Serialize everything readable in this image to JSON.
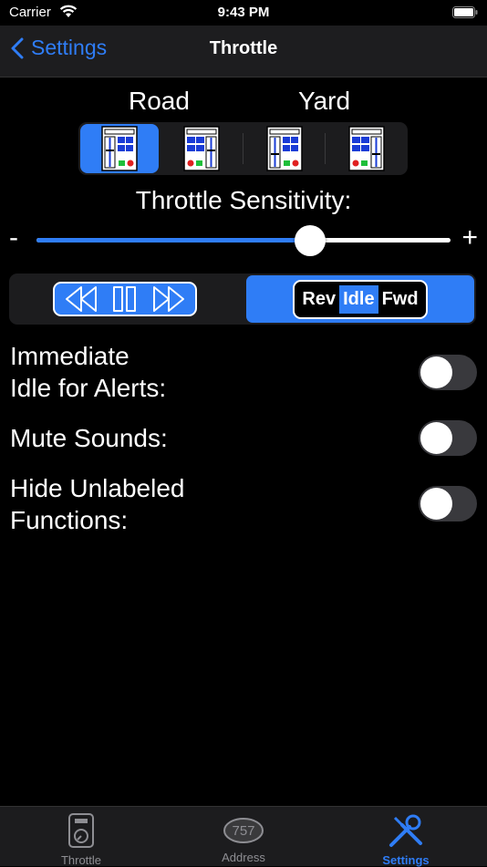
{
  "status_bar": {
    "carrier": "Carrier",
    "time": "9:43 PM"
  },
  "nav": {
    "back_label": "Settings",
    "title": "Throttle"
  },
  "layout": {
    "road_label": "Road",
    "yard_label": "Yard",
    "options": [
      {
        "name": "road-left",
        "selected": true
      },
      {
        "name": "road-right",
        "selected": false
      },
      {
        "name": "yard-left",
        "selected": false
      },
      {
        "name": "yard-right",
        "selected": false
      }
    ]
  },
  "sensitivity": {
    "label": "Throttle Sensitivity:",
    "minus": "-",
    "plus": "+",
    "value": 0.66
  },
  "direction_style": {
    "selected": "rif",
    "rif_labels": {
      "rev": "Rev",
      "idle": "Idle",
      "fwd": "Fwd"
    }
  },
  "settings": [
    {
      "label_line1": "Immediate",
      "label_line2": "Idle for Alerts:",
      "on": false
    },
    {
      "label_line1": "Mute Sounds:",
      "label_line2": "",
      "on": false
    },
    {
      "label_line1": "Hide Unlabeled",
      "label_line2": "Functions:",
      "on": false
    }
  ],
  "tabbar": {
    "tabs": [
      {
        "label": "Throttle",
        "icon": "throttle-icon",
        "active": false
      },
      {
        "label": "Address",
        "icon": "address-icon",
        "badge": "757",
        "active": false
      },
      {
        "label": "Settings",
        "icon": "settings-icon",
        "active": true
      }
    ]
  },
  "colors": {
    "accent": "#2f7df6",
    "background": "#000000",
    "panel": "#1c1c1e"
  }
}
